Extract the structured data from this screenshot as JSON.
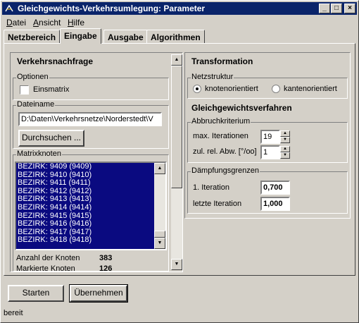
{
  "window": {
    "title": "Gleichgewichts-Verkehrsumlegung: Parameter"
  },
  "menu": [
    {
      "label": "Datei",
      "accel": "D",
      "rest": "atei"
    },
    {
      "label": "Ansicht",
      "accel": "A",
      "rest": "nsicht"
    },
    {
      "label": "Hilfe",
      "accel": "H",
      "rest": "ilfe"
    }
  ],
  "tabs": [
    "Netzbereich",
    "Eingabe",
    "Ausgabe",
    "Algorithmen"
  ],
  "active_tab": "Eingabe",
  "left": {
    "heading": "Verkehrsnachfrage",
    "optionen_label": "Optionen",
    "einsmatrix_label": "Einsmatrix",
    "einsmatrix_checked": false,
    "dateiname_label": "Dateiname",
    "dateiname_value": "D:\\Daten\\Verkehrsnetze\\Norderstedt\\V",
    "durchsuchen_label": "Durchsuchen ...",
    "matrixknoten_label": "Matrixknoten",
    "matrixknoten": [
      "BEZIRK: 9409 (9409)",
      "BEZIRK: 9410 (9410)",
      "BEZIRK: 9411 (9411)",
      "BEZIRK: 9412 (9412)",
      "BEZIRK: 9413 (9413)",
      "BEZIRK: 9414 (9414)",
      "BEZIRK: 9415 (9415)",
      "BEZIRK: 9416 (9416)",
      "BEZIRK: 9417 (9417)",
      "BEZIRK: 9418 (9418)"
    ],
    "anzahl_label": "Anzahl der Knoten",
    "anzahl_value": "383",
    "markierte_label": "Markierte Knoten",
    "markierte_value": "126"
  },
  "right": {
    "heading": "Transformation",
    "netzstruktur_label": "Netzstruktur",
    "radio_knoten": "knotenorientiert",
    "radio_kanten": "kantenorientiert",
    "selected_radio": "knotenorientiert",
    "gleichgewicht_heading": "Gleichgewichtsverfahren",
    "abbruch_label": "Abbruchkriterium",
    "max_iter_label": "max. Iterationen",
    "max_iter_value": "19",
    "zul_label": "zul. rel. Abw. [°/oo]",
    "zul_value": "1",
    "daempfung_label": "Dämpfungsgrenzen",
    "iter1_label": "1. Iteration",
    "iter1_value": "0,700",
    "letzte_label": "letzte Iteration",
    "letzte_value": "1,000"
  },
  "buttons": {
    "starten": "Starten",
    "uebernehmen": "Übernehmen"
  },
  "status": "bereit"
}
